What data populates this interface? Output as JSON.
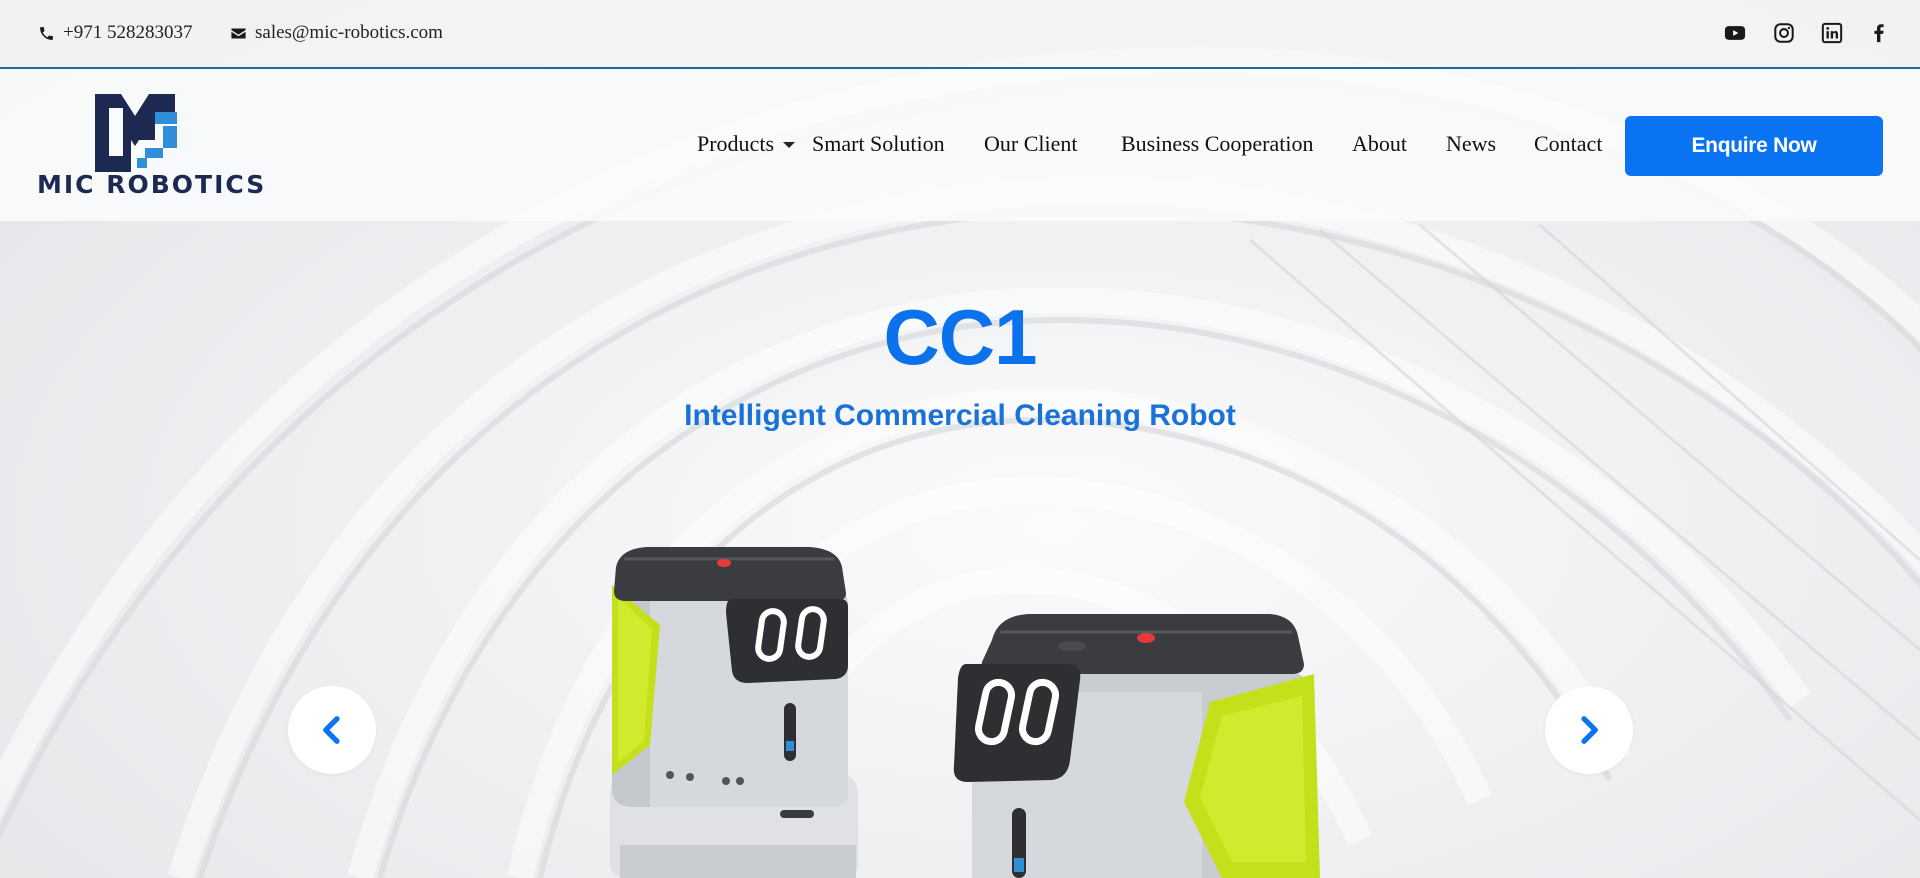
{
  "topbar": {
    "phone": "+971 528283037",
    "email": "sales@mic-robotics.com",
    "social": [
      "youtube-icon",
      "instagram-icon",
      "linkedin-icon",
      "facebook-icon"
    ]
  },
  "logo": {
    "text": "MIC ROBOTICS"
  },
  "nav": {
    "items": [
      {
        "label": "Products",
        "has_dropdown": true
      },
      {
        "label": "Smart Solution"
      },
      {
        "label": "Our Client"
      },
      {
        "label": "Business Cooperation"
      },
      {
        "label": "About"
      },
      {
        "label": "News"
      },
      {
        "label": "Contact"
      }
    ],
    "cta": "Enquire Now"
  },
  "hero": {
    "title": "CC1",
    "subtitle": "Intelligent Commercial Cleaning Robot"
  },
  "colors": {
    "brand_blue": "#0a73f2",
    "title_blue": "#0b72ec",
    "logo_navy": "#1c2a52",
    "robot_lime": "#c4e01a"
  }
}
